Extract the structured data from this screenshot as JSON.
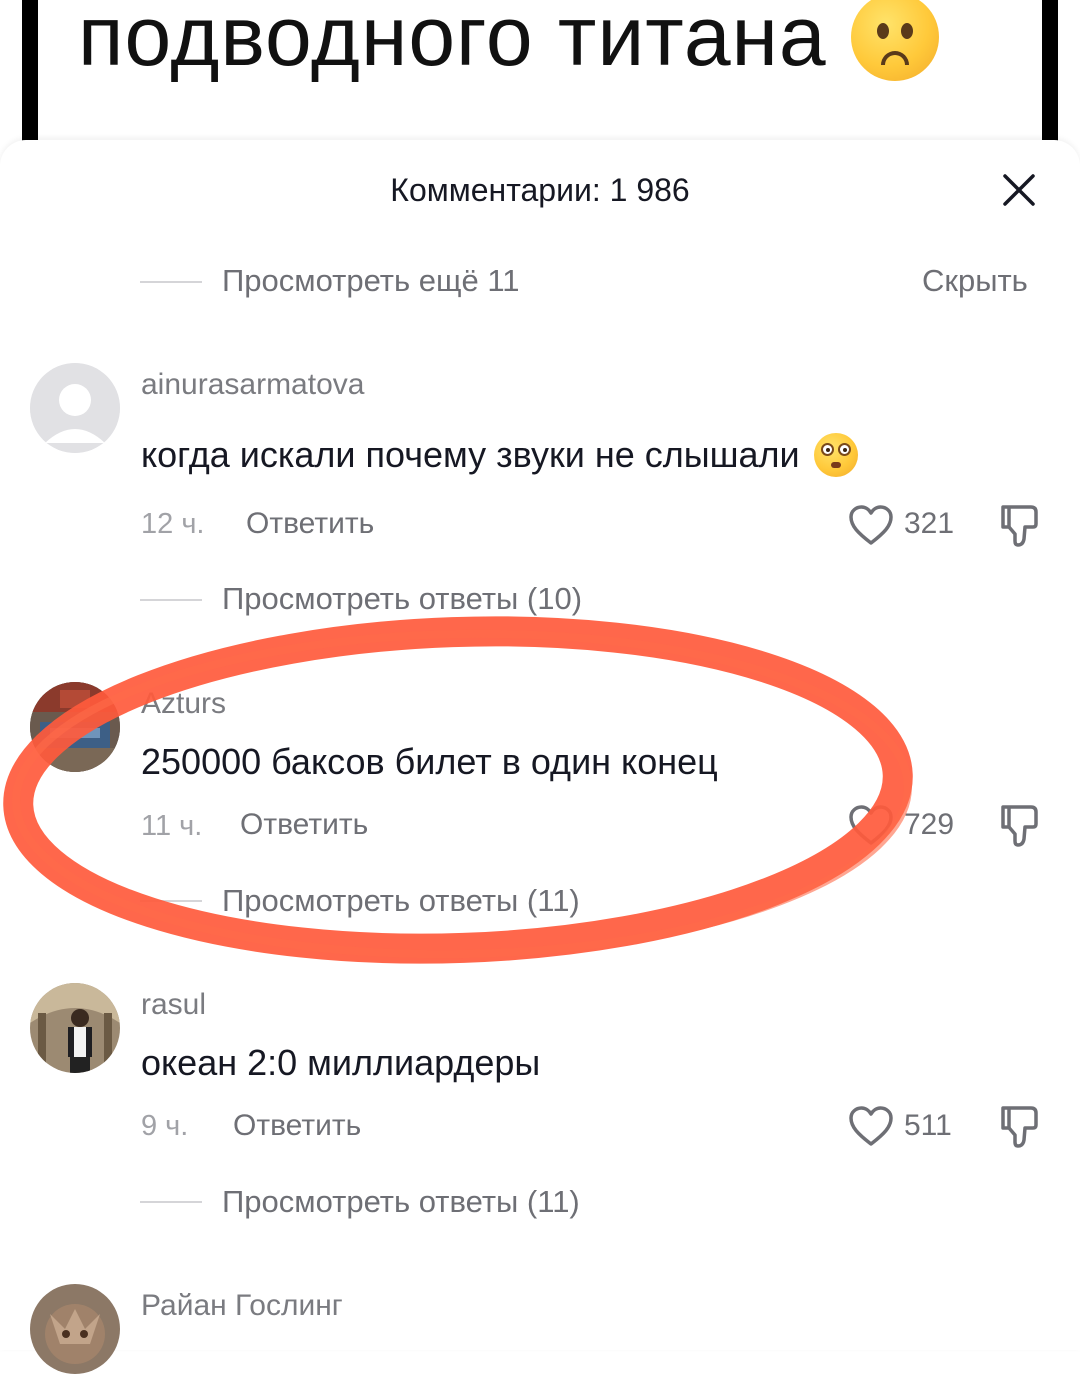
{
  "video": {
    "caption": "подводного титана"
  },
  "sheet": {
    "title": "Комментарии: 1 986",
    "view_more": "Просмотреть ещё 11",
    "hide": "Скрыть"
  },
  "comments": [
    {
      "username": "ainurasarmatova",
      "text": "когда искали почему звуки не слышали",
      "time": "12 ч.",
      "reply": "Ответить",
      "likes": "321",
      "view_replies": "Просмотреть ответы (10)"
    },
    {
      "username": "Azturs",
      "text": "250000 баксов билет в один конец",
      "time": "11 ч.",
      "reply": "Ответить",
      "likes": "729",
      "view_replies": "Просмотреть ответы (11)"
    },
    {
      "username": "rasul",
      "text": "океан 2:0 миллиардеры",
      "time": "9 ч.",
      "reply": "Ответить",
      "likes": "511",
      "view_replies": "Просмотреть ответы (11)"
    },
    {
      "username": "Райан Гослинг"
    }
  ],
  "colors": {
    "highlight_ring": "#ff5a3c",
    "muted_text": "#6e6f75"
  }
}
